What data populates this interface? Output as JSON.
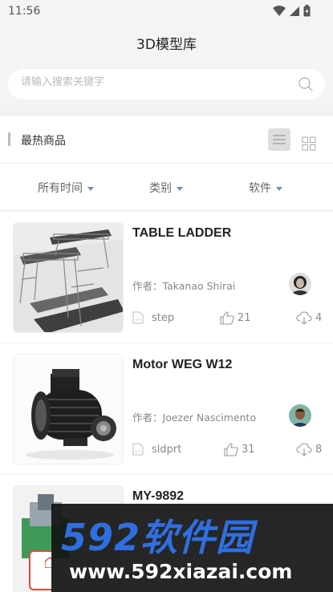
{
  "status": {
    "time": "11:56"
  },
  "header": {
    "title": "3D模型库"
  },
  "search": {
    "placeholder": "请输入搜索关键字"
  },
  "section": {
    "title": "最热商品"
  },
  "filters": [
    {
      "label": "所有时间"
    },
    {
      "label": "类别"
    },
    {
      "label": "软件"
    }
  ],
  "items": [
    {
      "title": "TABLE LADDER",
      "author_label": "作者：",
      "author": "Takanao Shirai",
      "format": "step",
      "likes": "21",
      "downloads": "4"
    },
    {
      "title": "Motor WEG W12",
      "author_label": "作者：",
      "author": "Joezer Nascimento",
      "format": "sldprt",
      "likes": "31",
      "downloads": "8"
    },
    {
      "title": "MY-9892"
    }
  ],
  "watermark": {
    "brand": "592软件园",
    "url": "www.592xiazai.com"
  },
  "colors": {
    "accent": "#6b8bc4",
    "watermark_blue": "#2f6fe0",
    "tab_red": "#e04a3a"
  }
}
